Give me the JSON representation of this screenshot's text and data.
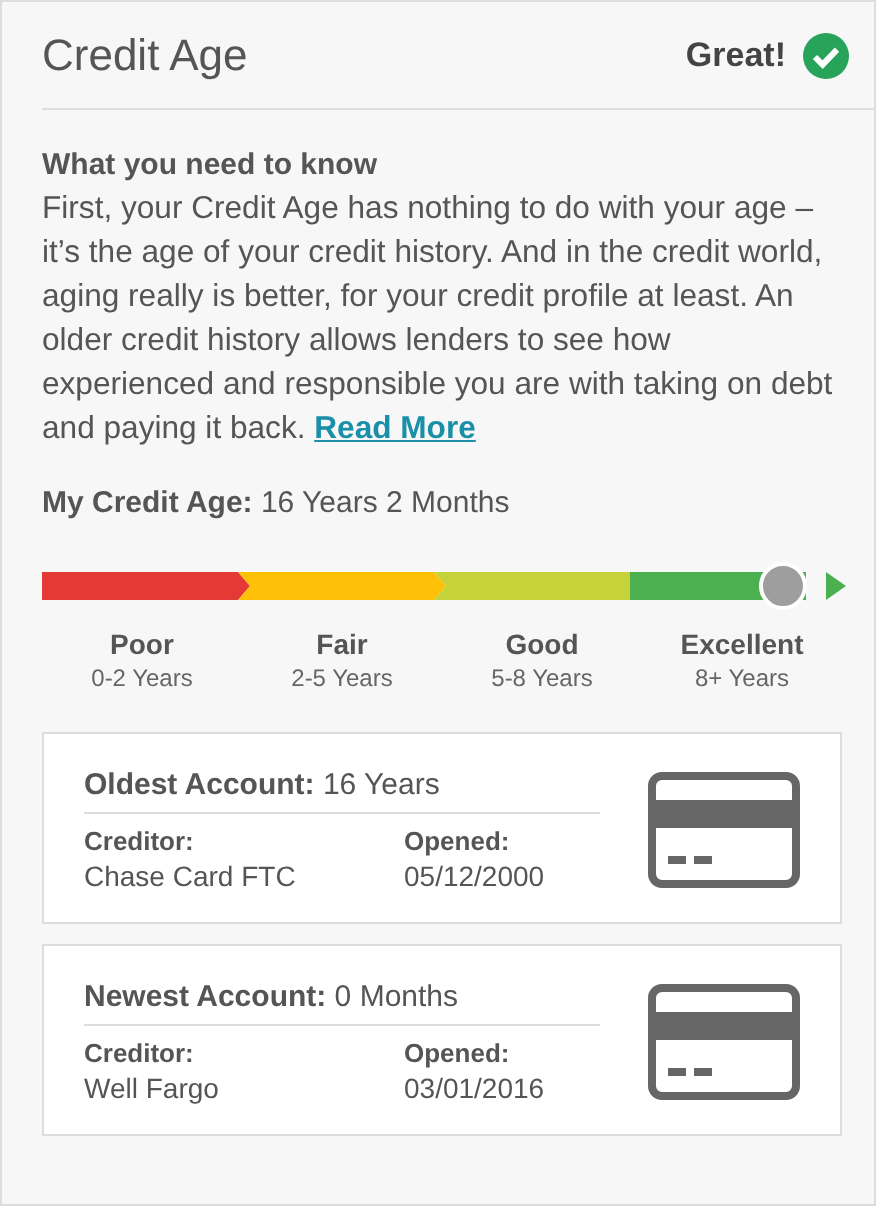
{
  "header": {
    "title": "Credit Age",
    "rating": "Great!",
    "rating_ok": true
  },
  "info": {
    "heading": "What you need to know",
    "body": "First, your Credit Age has nothing to do with your age – it’s the age of your credit history. And in the credit world, aging really is better, for your credit profile at least. An older credit history allows lenders to see how experienced and responsible you are with taking on debt and paying it back.",
    "link": "Read More"
  },
  "credit_age": "**My Credit Age:** 16 Years 2 Months",
  "meter": {
    "level": 0.94,
    "segments": [
      {
        "label": "Poor",
        "range": "0-2 Years",
        "color": "#e53935"
      },
      {
        "label": "Fair",
        "range": "2-5 Years",
        "color": "#ffc107"
      },
      {
        "label": "Good",
        "range": "5-8 Years",
        "color": "#c6d23a"
      },
      {
        "label": "Excellent",
        "range": "8+ Years",
        "color": "#4caf50"
      }
    ]
  },
  "accounts": [
    {
      "title": "**Oldest Account:** 16 Years",
      "creditor_label": "Creditor:",
      "creditor": "Chase Card FTC",
      "opened_label": "Opened:",
      "opened": "05/12/2000"
    },
    {
      "title": "**Newest Account:** 0 Months",
      "creditor_label": "Creditor:",
      "creditor": "Well Fargo",
      "opened_label": "Opened:",
      "opened": "03/01/2016"
    }
  ]
}
